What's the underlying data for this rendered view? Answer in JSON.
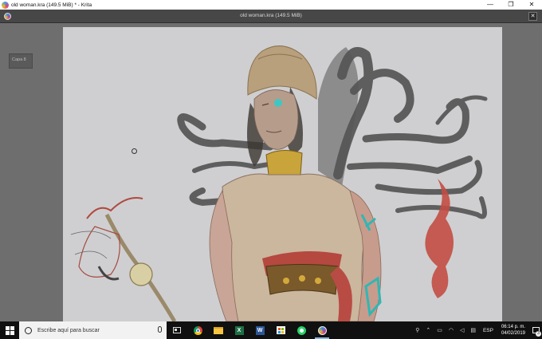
{
  "window": {
    "title": "old woman.kra (149.5 MiB) * - Krita",
    "min_glyph": "—",
    "max_glyph": "❐",
    "close_glyph": "✕"
  },
  "document": {
    "tab_title": "old woman.kra (149.5 MiB)",
    "close_glyph": "✕"
  },
  "canvas": {
    "layer_label": "Capa 8"
  },
  "taskbar": {
    "search_placeholder": "Escribe aquí para buscar",
    "excel_letter": "X",
    "word_letter": "W",
    "language": "ESP",
    "time": "06:14 p. m.",
    "date": "04/02/2019",
    "notification_count": "3",
    "tray_icons": [
      "people-icon",
      "chevron-up-icon",
      "network-icon",
      "wifi-icon",
      "volume-icon",
      "keyboard-icon"
    ]
  },
  "colors": {
    "canvas_bg": "#cfcfd1",
    "workspace_bg": "#6e6e6e",
    "taskbar_bg": "#101010"
  }
}
